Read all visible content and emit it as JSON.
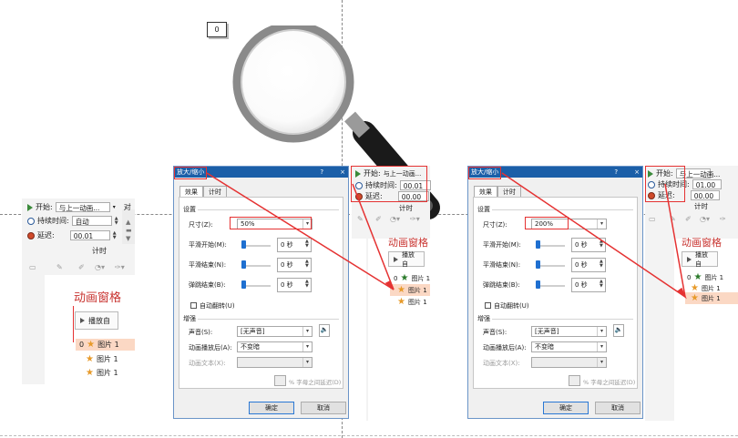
{
  "counter": "0",
  "left_panel": {
    "start_label": "开始:",
    "start_value": "与上一动画...",
    "duration_label": "持续时间:",
    "duration_value": "自动",
    "delay_label": "延迟:",
    "delay_value": "00.01",
    "timing_label": "计时",
    "align_label": "对",
    "pane_title": "动画窗格",
    "play_button": "播放自",
    "items": [
      {
        "num": "0",
        "label": "图片 1"
      },
      {
        "num": "",
        "label": "图片 1"
      },
      {
        "num": "",
        "label": "图片 1"
      }
    ]
  },
  "dialog_left": {
    "title": "放大/缩小",
    "help": "?",
    "close": "×",
    "tab_effect": "效果",
    "tab_timing": "计时",
    "settings_header": "设置",
    "size_label": "尺寸(Z):",
    "size_value": "50%",
    "smooth_start_label": "平滑开始(M):",
    "smooth_start_value": "0 秒",
    "smooth_end_label": "平滑结束(N):",
    "smooth_end_value": "0 秒",
    "bounce_end_label": "弹跳结束(B):",
    "bounce_end_value": "0 秒",
    "auto_reverse_label": "自动翻转(U)",
    "enhance_header": "增强",
    "sound_label": "声音(S):",
    "sound_value": "[无声音]",
    "after_anim_label": "动画播放后(A):",
    "after_anim_value": "不变暗",
    "anim_text_label": "动画文本(X):",
    "delay_between_letters": "% 字母之间延迟(D)",
    "ok": "确定",
    "cancel": "取消"
  },
  "timing_left": {
    "start_label": "开始:",
    "start_value": "与上一动画...",
    "duration_label": "持续时间:",
    "duration_value": "00.01",
    "delay_label": "延迟:",
    "delay_value": "00.00",
    "timing_label": "计时",
    "pane_title": "动画窗格",
    "play_button": "播放自",
    "items": [
      {
        "num": "0",
        "label": "图片 1"
      },
      {
        "num": "",
        "label": "图片 1"
      },
      {
        "num": "",
        "label": "图片 1"
      }
    ]
  },
  "dialog_right": {
    "title": "放大/缩小",
    "help": "?",
    "close": "×",
    "tab_effect": "效果",
    "tab_timing": "计时",
    "settings_header": "设置",
    "size_label": "尺寸(Z):",
    "size_value": "200%",
    "smooth_start_label": "平滑开始(M):",
    "smooth_start_value": "0 秒",
    "smooth_end_label": "平滑结束(N):",
    "smooth_end_value": "0 秒",
    "bounce_end_label": "弹跳结束(B):",
    "bounce_end_value": "0 秒",
    "auto_reverse_label": "自动翻转(U)",
    "enhance_header": "增强",
    "sound_label": "声音(S):",
    "sound_value": "[无声音]",
    "after_anim_label": "动画播放后(A):",
    "after_anim_value": "不变暗",
    "anim_text_label": "动画文本(X):",
    "delay_between_letters": "% 字母之间延迟(D)",
    "ok": "确定",
    "cancel": "取消"
  },
  "timing_right": {
    "start_label": "开始:",
    "start_value": "与上一动画...",
    "duration_label": "持续时间:",
    "duration_value": "01.00",
    "delay_label": "延迟:",
    "delay_value": "00.00",
    "timing_label": "计时",
    "pane_title": "动画窗格",
    "play_button": "播放自",
    "items": [
      {
        "num": "0",
        "label": "图片 1"
      },
      {
        "num": "",
        "label": "图片 1"
      },
      {
        "num": "",
        "label": "图片 1"
      }
    ]
  },
  "colors": {
    "annotation_red": "#e53232",
    "title_blue": "#1b5fa8",
    "highlight": "#fbd8c4",
    "star_orange": "#e79a2a",
    "star_green": "#2a7a2a"
  }
}
